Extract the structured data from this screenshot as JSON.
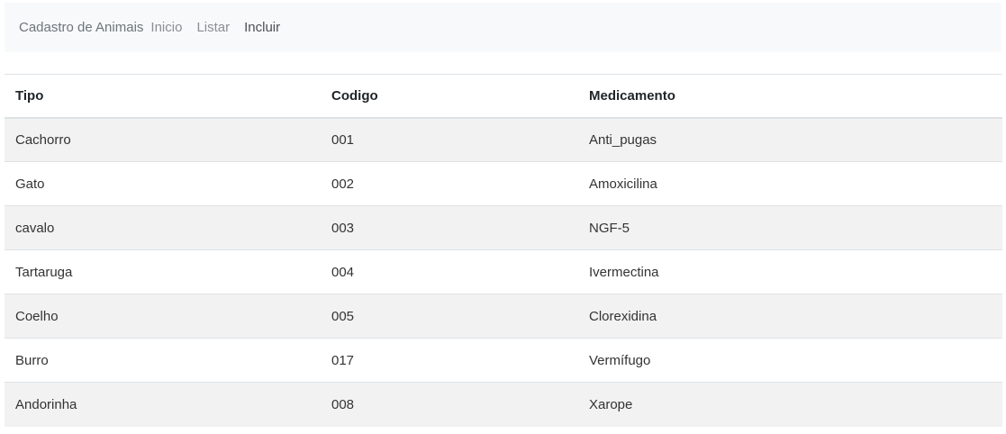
{
  "navbar": {
    "brand": "Cadastro de Animais",
    "links": [
      "Inicio",
      "Listar",
      "Incluir"
    ]
  },
  "table": {
    "headers": [
      "Tipo",
      "Codigo",
      "Medicamento"
    ],
    "rows": [
      [
        "Cachorro",
        "001",
        "Anti_pugas"
      ],
      [
        "Gato",
        "002",
        "Amoxicilina"
      ],
      [
        "cavalo",
        "003",
        "NGF-5"
      ],
      [
        "Tartaruga",
        "004",
        "Ivermectina"
      ],
      [
        "Coelho",
        "005",
        "Clorexidina"
      ],
      [
        "Burro",
        "017",
        "Vermífugo"
      ],
      [
        "Andorinha",
        "008",
        "Xarope"
      ]
    ]
  }
}
